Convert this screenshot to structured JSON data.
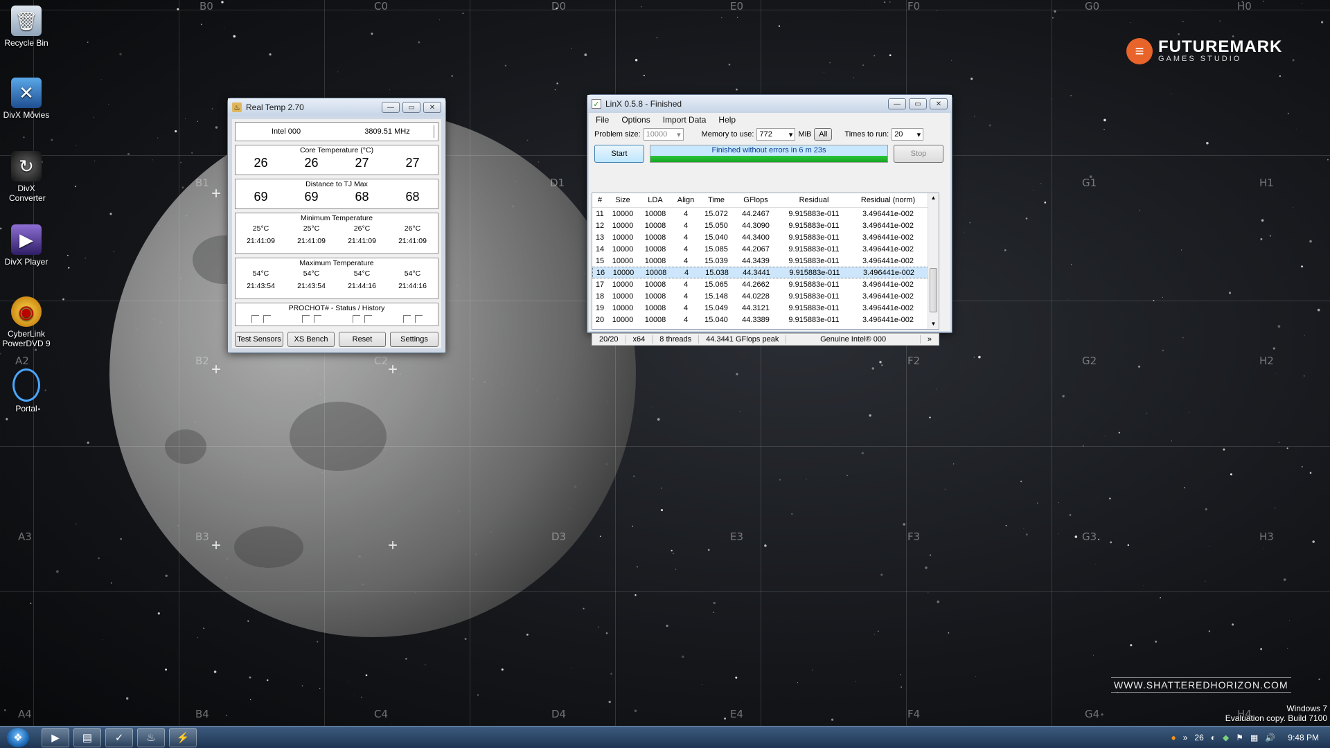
{
  "desktop": {
    "icons": [
      {
        "label": "Recycle Bin",
        "icon": "recycle-bin-icon"
      },
      {
        "label": "DivX Movies",
        "icon": "divx-movies-icon"
      },
      {
        "label": "DivX Converter",
        "icon": "divx-converter-icon"
      },
      {
        "label": "DivX Player",
        "icon": "divx-player-icon"
      },
      {
        "label": "CyberLink PowerDVD 9",
        "icon": "powerdvd-icon"
      },
      {
        "label": "Portal",
        "icon": "portal-icon"
      }
    ],
    "grid_labels": [
      "B0",
      "C0",
      "D0",
      "E0",
      "F0",
      "G0",
      "H0",
      "B1",
      "D1",
      "G1",
      "H1",
      "A2",
      "B2",
      "C2",
      "F2",
      "G2",
      "H2",
      "A3",
      "B3",
      "D3",
      "E3",
      "F3",
      "G3",
      "H3",
      "A4",
      "B4",
      "C4",
      "D4",
      "E4",
      "F4",
      "G4",
      "H4"
    ],
    "logo": {
      "name": "FUTUREMARK",
      "sub": "GAMES STUDIO"
    },
    "url": "WWW.SHATTEREDHORIZON.COM",
    "watermark": {
      "line1": "Windows 7",
      "line2": "Evaluation copy. Build 7100"
    }
  },
  "realtemp": {
    "title": "Real Temp 2.70",
    "cpu": "Intel 000",
    "freq": "3809.51 MHz",
    "core_temp_label": "Core Temperature (°C)",
    "core_temps": [
      "26",
      "26",
      "27",
      "27"
    ],
    "tj_label": "Distance to TJ Max",
    "tj": [
      "69",
      "69",
      "68",
      "68"
    ],
    "min_label": "Minimum Temperature",
    "min_temps": [
      "25°C",
      "25°C",
      "26°C",
      "26°C"
    ],
    "min_times": [
      "21:41:09",
      "21:41:09",
      "21:41:09",
      "21:41:09"
    ],
    "max_label": "Maximum Temperature",
    "max_temps": [
      "54°C",
      "54°C",
      "54°C",
      "54°C"
    ],
    "max_times": [
      "21:43:54",
      "21:43:54",
      "21:44:16",
      "21:44:16"
    ],
    "prochot_label": "PROCHOT#  -  Status / History",
    "buttons": {
      "test": "Test Sensors",
      "xs": "XS Bench",
      "reset": "Reset",
      "settings": "Settings"
    }
  },
  "linx": {
    "title": "LinX 0.5.8 - Finished",
    "menu": [
      "File",
      "Options",
      "Import Data",
      "Help"
    ],
    "problem_size_label": "Problem size:",
    "problem_size": "10000",
    "memory_label": "Memory to use:",
    "memory": "772",
    "memory_unit": "MiB",
    "all_label": "All",
    "times_label": "Times to run:",
    "times": "20",
    "start_label": "Start",
    "progress_text": "Finished without errors in 6 m 23s",
    "progress": 1.0,
    "stop_label": "Stop",
    "columns": [
      "#",
      "Size",
      "LDA",
      "Align",
      "Time",
      "GFlops",
      "Residual",
      "Residual (norm)"
    ],
    "rows": [
      [
        "11",
        "10000",
        "10008",
        "4",
        "15.072",
        "44.2467",
        "9.915883e-011",
        "3.496441e-002"
      ],
      [
        "12",
        "10000",
        "10008",
        "4",
        "15.050",
        "44.3090",
        "9.915883e-011",
        "3.496441e-002"
      ],
      [
        "13",
        "10000",
        "10008",
        "4",
        "15.040",
        "44.3400",
        "9.915883e-011",
        "3.496441e-002"
      ],
      [
        "14",
        "10000",
        "10008",
        "4",
        "15.085",
        "44.2067",
        "9.915883e-011",
        "3.496441e-002"
      ],
      [
        "15",
        "10000",
        "10008",
        "4",
        "15.039",
        "44.3439",
        "9.915883e-011",
        "3.496441e-002"
      ],
      [
        "16",
        "10000",
        "10008",
        "4",
        "15.038",
        "44.3441",
        "9.915883e-011",
        "3.496441e-002"
      ],
      [
        "17",
        "10000",
        "10008",
        "4",
        "15.065",
        "44.2662",
        "9.915883e-011",
        "3.496441e-002"
      ],
      [
        "18",
        "10000",
        "10008",
        "4",
        "15.148",
        "44.0228",
        "9.915883e-011",
        "3.496441e-002"
      ],
      [
        "19",
        "10000",
        "10008",
        "4",
        "15.049",
        "44.3121",
        "9.915883e-011",
        "3.496441e-002"
      ],
      [
        "20",
        "10000",
        "10008",
        "4",
        "15.040",
        "44.3389",
        "9.915883e-011",
        "3.496441e-002"
      ]
    ],
    "selected_row": "16",
    "status": {
      "runs": "20/20",
      "arch": "x64",
      "threads": "8 threads",
      "peak": "44.3441 GFlops peak",
      "cpu": "Genuine Intel® 000",
      "more": "»"
    }
  },
  "taskbar": {
    "tray_temp": "26",
    "clock": "9:48 PM",
    "show_hidden": "»"
  }
}
